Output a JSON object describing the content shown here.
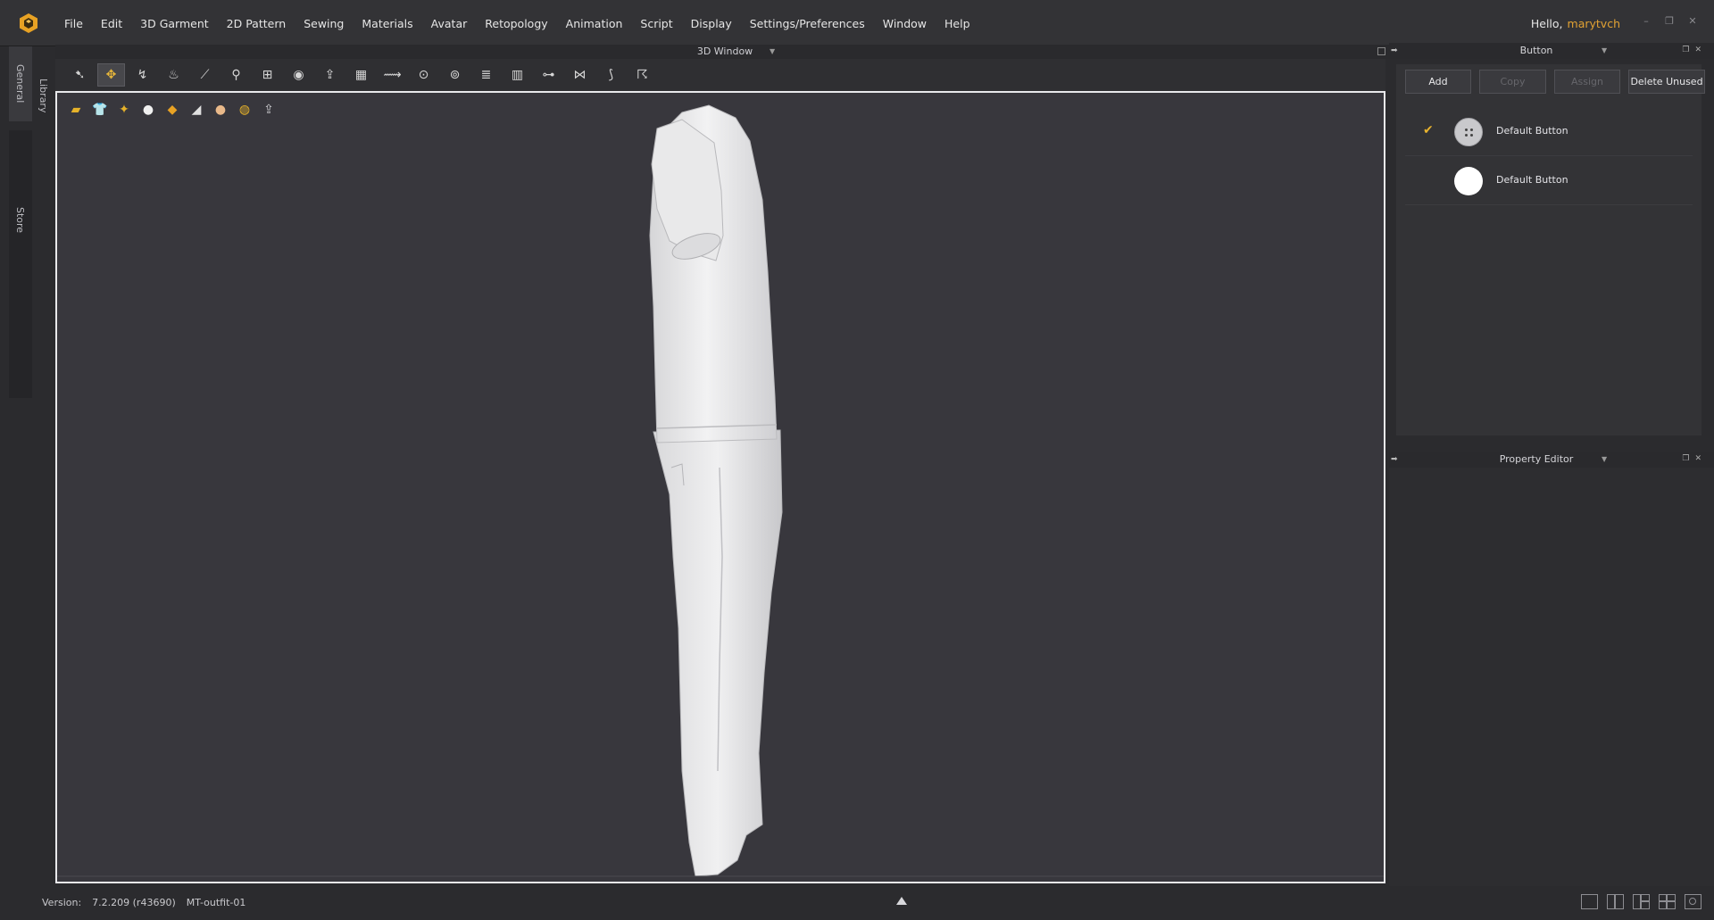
{
  "menubar": {
    "logo_icon": "clo-cube-logo",
    "items": [
      "File",
      "Edit",
      "3D Garment",
      "2D Pattern",
      "Sewing",
      "Materials",
      "Avatar",
      "Retopology",
      "Animation",
      "Script",
      "Display",
      "Settings/Preferences",
      "Window",
      "Help"
    ],
    "greeting": "Hello,",
    "username": "marytvch"
  },
  "sidetabs": {
    "general": "General",
    "library": "Library",
    "store": "Store"
  },
  "window3d": {
    "title": "3D Window",
    "toolbar_icons": [
      "select-icon",
      "move-icon",
      "fold-icon",
      "garment-select-icon",
      "measure-icon",
      "avatar-pose-icon",
      "tack-icon",
      "pin-icon",
      "fold-arrangement-icon",
      "mesh-icon",
      "strap-icon",
      "button-icon",
      "buttonhole-icon",
      "zipper-icon",
      "puckering-icon",
      "trim-icon",
      "seam-icon",
      "pipe-icon",
      "run-icon"
    ],
    "view_icons": [
      "texture-view-icon",
      "garment-view-icon",
      "sewing-view-icon",
      "avatar-view-icon",
      "fabric-view-icon",
      "shading-view-icon",
      "skin-view-icon",
      "environment-view-icon",
      "export-icon"
    ]
  },
  "status": {
    "version_label": "Version:",
    "version": "7.2.209 (r43690)",
    "file": "MT-outfit-01"
  },
  "button_panel": {
    "title": "Button",
    "buttons": {
      "add": "Add",
      "copy": "Copy",
      "assign": "Assign",
      "delete_unused": "Delete Unused"
    },
    "items": [
      {
        "name": "Default Button",
        "selected": true,
        "style": "four-hole"
      },
      {
        "name": "Default Button",
        "selected": false,
        "style": "plain"
      }
    ]
  },
  "property_editor": {
    "title": "Property Editor"
  },
  "colors": {
    "accent": "#e8b32e",
    "username": "#e2a233",
    "viewport_bg": "#38373d"
  }
}
